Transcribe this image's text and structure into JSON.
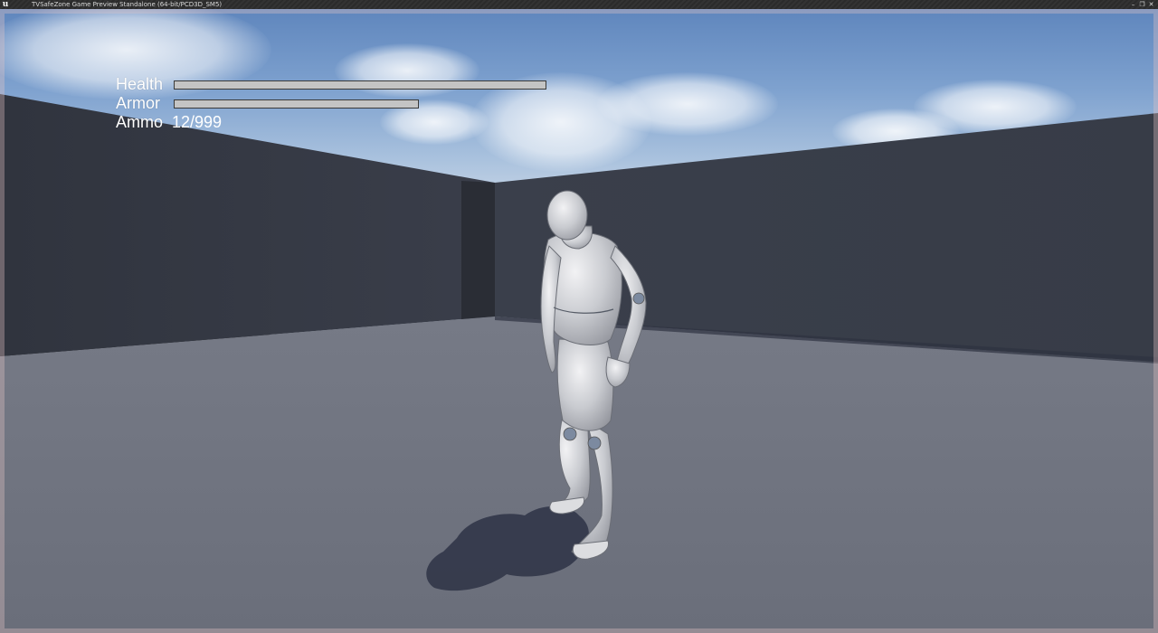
{
  "window": {
    "title": "TVSafeZone Game Preview Standalone (64-bit/PCD3D_SM5)",
    "logo_icon": "unreal-engine-logo-icon",
    "controls": [
      "minimize-icon",
      "restore-icon",
      "close-icon"
    ]
  },
  "hud": {
    "health": {
      "label": "Health",
      "value": 1.0
    },
    "armor": {
      "label": "Armor",
      "value": 1.0
    },
    "ammo": {
      "label": "Ammo",
      "value": "12/999"
    }
  },
  "colors": {
    "hud_text": "#ffffff",
    "bar_fill": "#c4c4c4",
    "bar_border": "#3a3a3a",
    "wall": "#3a3f4a",
    "floor": "#6c707c"
  }
}
